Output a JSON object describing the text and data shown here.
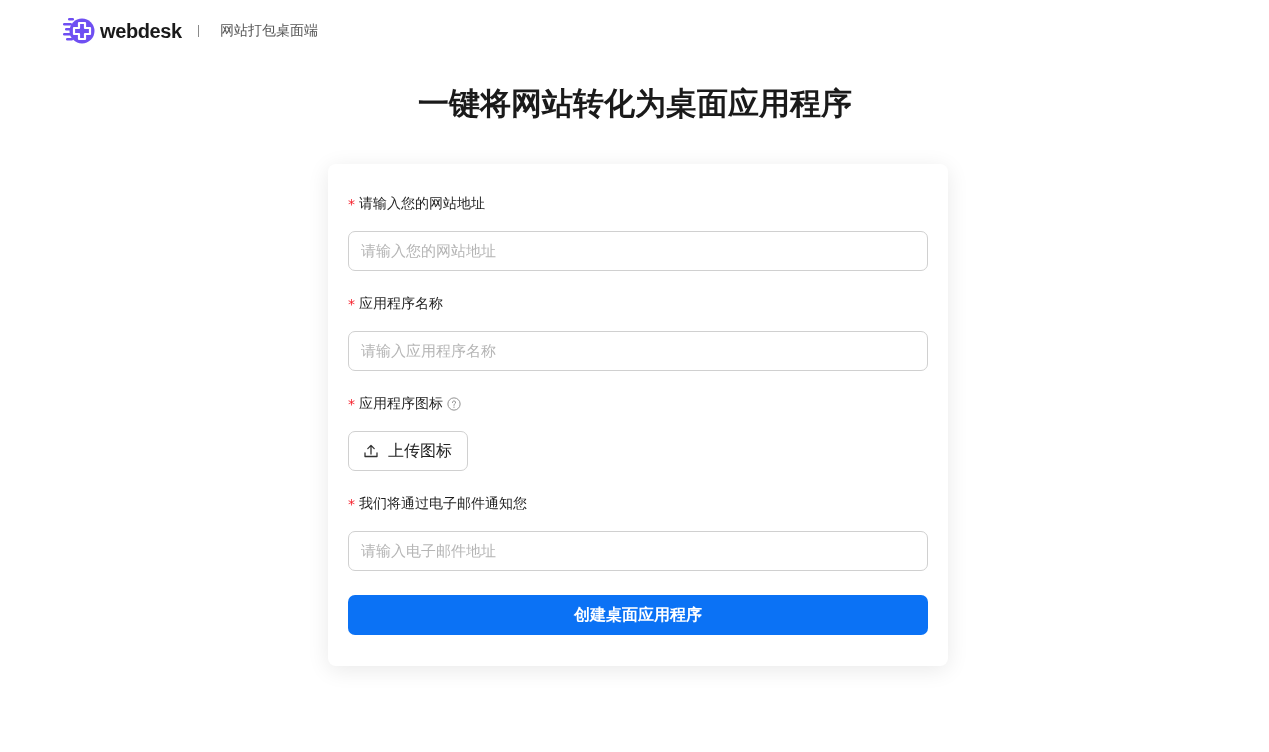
{
  "header": {
    "brand": "webdesk",
    "tagline": "网站打包桌面端"
  },
  "title": "一键将网站转化为桌面应用程序",
  "form": {
    "fields": [
      {
        "kind": "input",
        "required_mark": "*",
        "label": "请输入您的网站地址",
        "help": false,
        "placeholder": "请输入您的网站地址"
      },
      {
        "kind": "input",
        "required_mark": "*",
        "label": "应用程序名称",
        "help": false,
        "placeholder": "请输入应用程序名称"
      },
      {
        "kind": "upload",
        "required_mark": "*",
        "label": "应用程序图标",
        "help": true,
        "button": "上传图标"
      },
      {
        "kind": "input",
        "required_mark": "*",
        "label": "我们将通过电子邮件通知您",
        "help": false,
        "placeholder": "请输入电子邮件地址"
      }
    ],
    "submit": "创建桌面应用程序"
  }
}
